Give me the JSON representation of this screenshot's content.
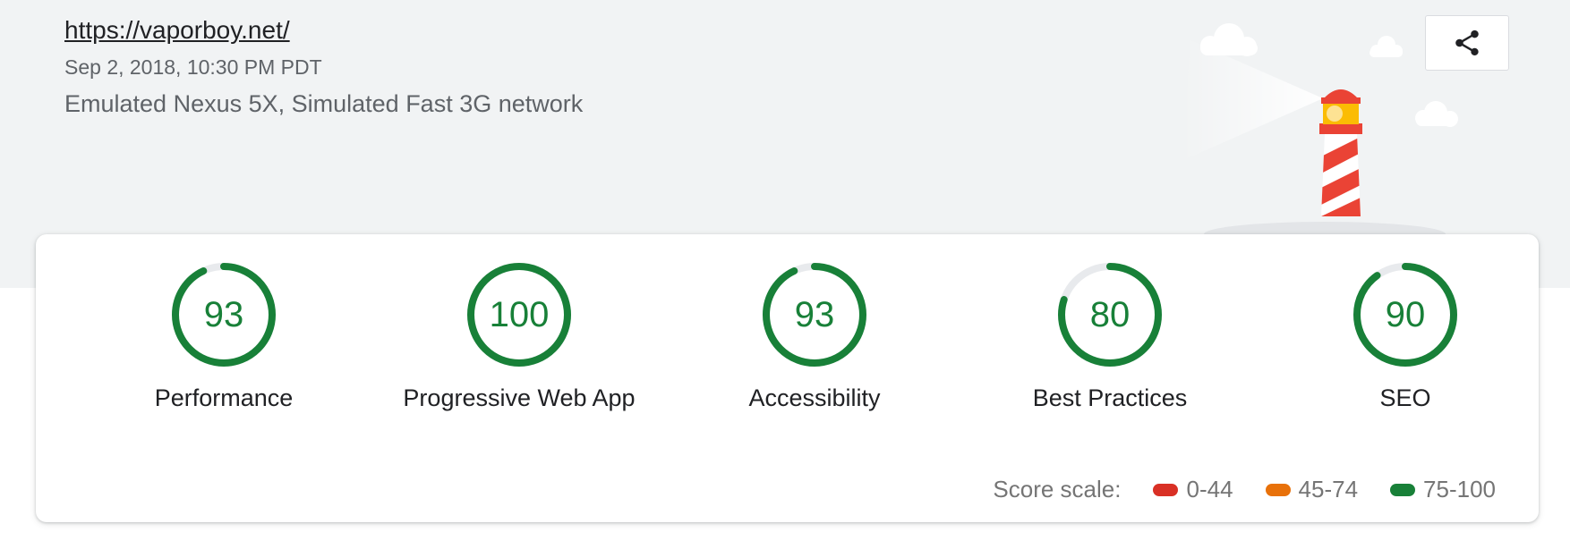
{
  "header": {
    "url": "https://vaporboy.net/",
    "timestamp": "Sep 2, 2018, 10:30 PM PDT",
    "environment": "Emulated Nexus 5X, Simulated Fast 3G network",
    "share_icon": "share-icon"
  },
  "colors": {
    "pass": "#188038",
    "average": "#e8710a",
    "fail": "#d93025",
    "header_background": "#f1f3f4"
  },
  "gauges": [
    {
      "score": "93",
      "label": "Performance",
      "fraction": 0.93
    },
    {
      "score": "100",
      "label": "Progressive Web App",
      "fraction": 1.0
    },
    {
      "score": "93",
      "label": "Accessibility",
      "fraction": 0.93
    },
    {
      "score": "80",
      "label": "Best Practices",
      "fraction": 0.8
    },
    {
      "score": "90",
      "label": "SEO",
      "fraction": 0.9
    }
  ],
  "scale": {
    "label": "Score scale:",
    "ranges": [
      {
        "range": "0-44",
        "color": "#d93025"
      },
      {
        "range": "45-74",
        "color": "#e8710a"
      },
      {
        "range": "75-100",
        "color": "#188038"
      }
    ]
  }
}
